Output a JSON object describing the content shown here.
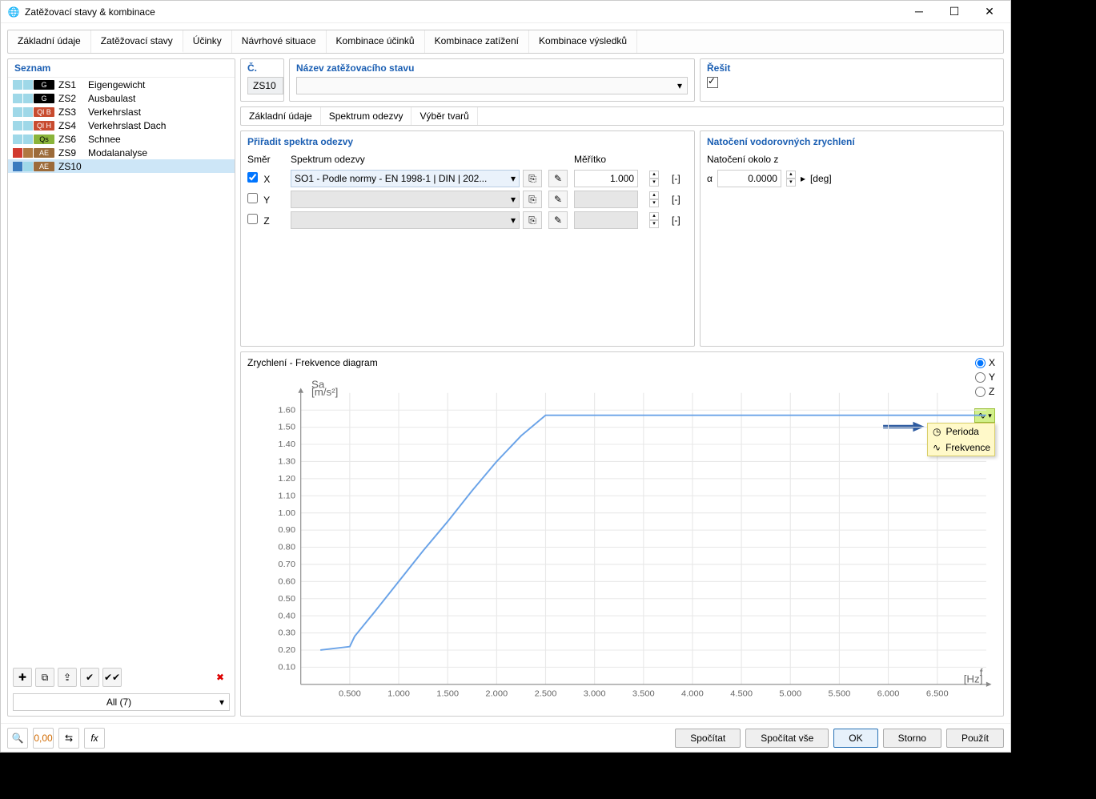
{
  "window": {
    "title": "Zatěžovací stavy & kombinace"
  },
  "tabs": [
    "Základní údaje",
    "Zatěžovací stavy",
    "Účinky",
    "Návrhové situace",
    "Kombinace účinků",
    "Kombinace zatížení",
    "Kombinace výsledků"
  ],
  "tabs_active": 1,
  "left_panel": {
    "title": "Seznam",
    "items": [
      {
        "sw": [
          "#9fd8e8",
          "#9fd8e8"
        ],
        "cat_bg": "#000",
        "cat_fg": "#fff",
        "cat": "G",
        "code": "ZS1",
        "name": "Eigengewicht"
      },
      {
        "sw": [
          "#9fd8e8",
          "#9fd8e8"
        ],
        "cat_bg": "#000",
        "cat_fg": "#fff",
        "cat": "G",
        "code": "ZS2",
        "name": "Ausbaulast"
      },
      {
        "sw": [
          "#9fd8e8",
          "#9fd8e8"
        ],
        "cat_bg": "#c84b2f",
        "cat_fg": "#fff",
        "cat": "Ql B",
        "code": "ZS3",
        "name": "Verkehrslast"
      },
      {
        "sw": [
          "#9fd8e8",
          "#9fd8e8"
        ],
        "cat_bg": "#c84b2f",
        "cat_fg": "#fff",
        "cat": "Ql H",
        "code": "ZS4",
        "name": "Verkehrslast Dach"
      },
      {
        "sw": [
          "#9fd8e8",
          "#9fd8e8"
        ],
        "cat_bg": "#8ab43a",
        "cat_fg": "#000",
        "cat": "Qs",
        "code": "ZS6",
        "name": "Schnee"
      },
      {
        "sw": [
          "#d13a2f",
          "#b07840"
        ],
        "cat_bg": "#9c6b3a",
        "cat_fg": "#fff",
        "cat": "AE",
        "code": "ZS9",
        "name": "Modalanalyse"
      },
      {
        "sw": [
          "#3a7bbf",
          "#9fd8e8"
        ],
        "cat_bg": "#9c6b3a",
        "cat_fg": "#fff",
        "cat": "AE",
        "code": "ZS10",
        "name": "",
        "selected": true
      }
    ],
    "filter": "All (7)"
  },
  "top_fields": {
    "num_label": "Č.",
    "num_value": "ZS10",
    "name_label": "Název zatěžovacího stavu",
    "name_value": "",
    "solve_label": "Řešit",
    "solve_checked": true
  },
  "sub_tabs": [
    "Základní údaje",
    "Spektrum odezvy",
    "Výběr tvarů"
  ],
  "sub_tabs_active": 1,
  "spectra": {
    "title": "Přiřadit spektra odezvy",
    "columns": {
      "dir": "Směr",
      "spec": "Spektrum odezvy",
      "scale": "Měřítko"
    },
    "rows": [
      {
        "dir": "X",
        "checked": true,
        "spec": "SO1 - Podle normy - EN 1998-1 | DIN | 202...",
        "scale": "1.000",
        "unit": "[-]"
      },
      {
        "dir": "Y",
        "checked": false,
        "spec": "",
        "scale": "",
        "unit": "[-]"
      },
      {
        "dir": "Z",
        "checked": false,
        "spec": "",
        "scale": "",
        "unit": "[-]"
      }
    ]
  },
  "rotation": {
    "title": "Natočení vodorovných zrychlení",
    "sub": "Natočení okolo z",
    "symbol": "α",
    "value": "0.0000",
    "unit": "[deg]"
  },
  "chart": {
    "title": "Zrychlení - Frekvence diagram",
    "axis_options": [
      "X",
      "Y",
      "Z"
    ],
    "axis_selected": "X",
    "y_unit": "Sa [m/s²]",
    "x_unit": "f [Hz]",
    "popup": [
      "Perioda",
      "Frekvence"
    ]
  },
  "chart_data": {
    "type": "line",
    "xlabel": "f [Hz]",
    "ylabel": "Sa [m/s²]",
    "xlim": [
      0,
      7.0
    ],
    "ylim": [
      0,
      1.7
    ],
    "xticks": [
      0.5,
      1.0,
      1.5,
      2.0,
      2.5,
      3.0,
      3.5,
      4.0,
      4.5,
      5.0,
      5.5,
      6.0,
      6.5
    ],
    "yticks": [
      0.1,
      0.2,
      0.3,
      0.4,
      0.5,
      0.6,
      0.7,
      0.8,
      0.9,
      1.0,
      1.1,
      1.2,
      1.3,
      1.4,
      1.5,
      1.6
    ],
    "series": [
      {
        "name": "X",
        "x": [
          0.2,
          0.5,
          0.55,
          0.65,
          0.75,
          1.0,
          1.25,
          1.5,
          1.75,
          2.0,
          2.25,
          2.5,
          7.0
        ],
        "y": [
          0.2,
          0.22,
          0.28,
          0.35,
          0.42,
          0.6,
          0.78,
          0.95,
          1.13,
          1.3,
          1.45,
          1.57,
          1.57
        ]
      }
    ]
  },
  "footer": {
    "buttons": {
      "calc": "Spočítat",
      "calc_all": "Spočítat vše",
      "ok": "OK",
      "cancel": "Storno",
      "apply": "Použít"
    }
  }
}
